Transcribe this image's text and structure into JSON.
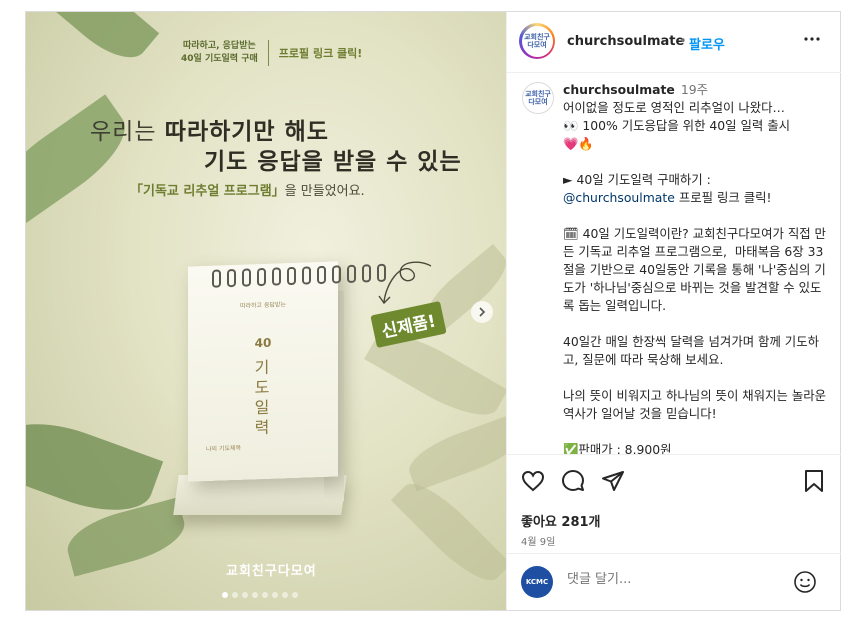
{
  "media": {
    "banner_left_line1": "따라하고, 응답받는",
    "banner_left_line2": "40일 기도일력 구매",
    "banner_right": "프로필 링크 클릭!",
    "headline_a": "우리는 ",
    "headline_b": "따라하기만 해도",
    "headline_2": "기도 응답을 받을 수 있는",
    "subline_hl": "「기독교 리추얼 프로그램」",
    "subline_rest": "을 만들었어요.",
    "calendar_sub": "따라하고 응답받는",
    "calendar_num": "40",
    "calendar_title": "기\n도\n일\n력",
    "calendar_foot": "나의 기도제목",
    "stamp": "신제품!",
    "brand": "교회친구다모여",
    "slides_total": 8,
    "slide_active": 1
  },
  "header": {
    "username": "churchsoulmate",
    "separator": "•",
    "follow": "팔로우",
    "avatar_text": "교회친구\n다모여"
  },
  "caption": {
    "username": "churchsoulmate",
    "time": "19주",
    "line1": "어이없을 정도로 영적인 리추얼이 나왔다…",
    "line2": "👀 100% 기도응답을 위한 40일 일력 출시",
    "line3": "💗🔥",
    "line4": "",
    "line5": "► 40일 기도일력 구매하기 :",
    "mention": "@churchsoulmate",
    "line6_rest": " 프로필 링크 클릭!",
    "line7": "",
    "line8": "🗓 40일 기도일력이란? 교회친구다모여가 직접 만든 기독교 리추얼 프로그램으로,  마태복음 6장 33절을 기반으로 40일동안 기록을 통해 '나'중심의 기도가 '하나님'중심으로 바뀌는 것을 발견할 수 있도록 돕는 일력입니다.",
    "line9": "",
    "line10": "40일간 매일 한장씩 달력을 넘겨가며 함께 기도하고, 질문에 따라 묵상해 보세요.",
    "line11": "",
    "line12": "나의 뜻이 비워지고 하나님의 뜻이 채워지는 놀라운 역사가 일어날 것을 믿습니다!",
    "line13": "",
    "line14": "✅판매가 : 8,900원"
  },
  "actions": {
    "likes": "좋아요 281개",
    "date": "4월 9일"
  },
  "comment": {
    "avatar_text": "KCMC",
    "placeholder": "댓글 달기..."
  },
  "colors": {
    "follow": "#0095f6",
    "mention": "#00376b",
    "stamp": "#6f8a2e"
  },
  "icons": [
    "heart-icon",
    "comment-icon",
    "share-icon",
    "bookmark-icon",
    "more-icon",
    "emoji-icon",
    "chevron-right-icon"
  ]
}
